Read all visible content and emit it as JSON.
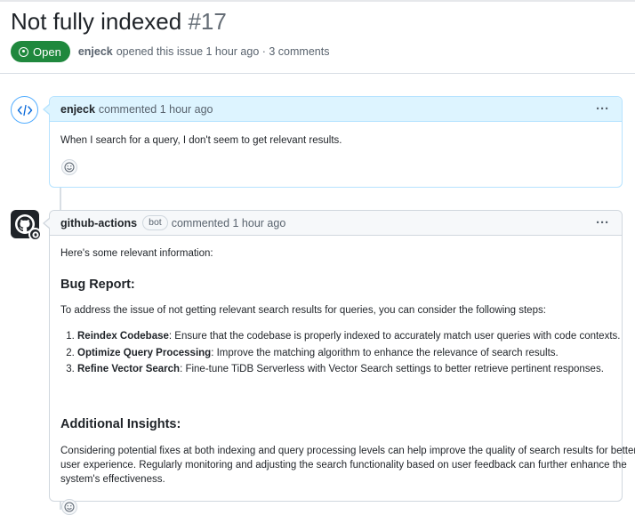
{
  "issue": {
    "title": "Not fully indexed",
    "number": "#17",
    "state": "Open",
    "author": "enjeck",
    "meta_text": "opened this issue 1 hour ago · 3 comments"
  },
  "comments": [
    {
      "author": "enjeck",
      "time_text": "commented 1 hour ago",
      "body": "When I search for a query, I don't seem to get relevant results.",
      "avatar_icon": "code-icon"
    },
    {
      "author": "github-actions",
      "bot_label": "bot",
      "time_text": "commented 1 hour ago",
      "intro": "Here's some relevant information:",
      "heading1": "Bug Report:",
      "para1": "To address the issue of not getting relevant search results for queries, you can consider the following steps:",
      "steps": [
        {
          "title": "Reindex Codebase",
          "text": ": Ensure that the codebase is properly indexed to accurately match user queries with code contexts."
        },
        {
          "title": "Optimize Query Processing",
          "text": ": Improve the matching algorithm to enhance the relevance of search results."
        },
        {
          "title": "Refine Vector Search",
          "text": ": Fine-tune TiDB Serverless with Vector Search settings to better retrieve pertinent responses."
        }
      ],
      "heading2": "Additional Insights:",
      "para2_l1": "Considering potential fixes at both indexing and query processing levels can help improve the quality of search results for better",
      "para2_l2": "user experience. Regularly monitoring and adjusting the search functionality based on user feedback can further enhance the",
      "para2_l3": "system's effectiveness.",
      "avatar_icon": "github-logo-icon"
    }
  ],
  "colors": {
    "open_green": "#1f883d",
    "author_header": "#ddf4ff",
    "author_border": "#b6e3ff"
  }
}
